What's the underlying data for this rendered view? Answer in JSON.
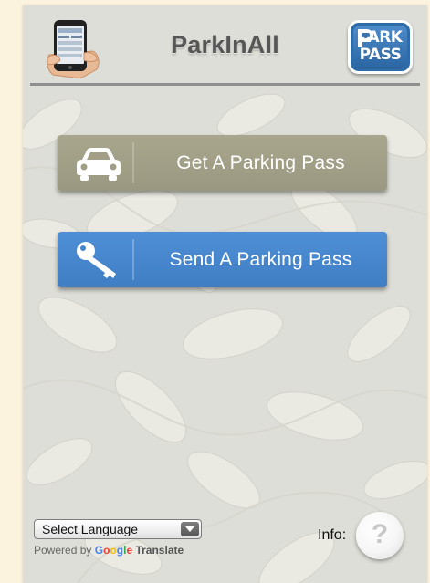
{
  "app": {
    "title": "ParkInAll"
  },
  "logos": {
    "left": "phone-hand-logo",
    "right": {
      "line1": "ARK",
      "line2": "PASS",
      "color": "#2e6ca9"
    }
  },
  "actions": [
    {
      "label": "Get A Parking Pass",
      "icon": "car-icon",
      "color": "#a9a68e"
    },
    {
      "label": "Send A Parking Pass",
      "icon": "key-icon",
      "color": "#4a88cf"
    }
  ],
  "footer": {
    "language_select": {
      "value": "Select Language"
    },
    "powered_by": {
      "prefix": "Powered by",
      "brand_letters": [
        "G",
        "o",
        "o",
        "g",
        "l",
        "e"
      ],
      "suffix": "Translate"
    },
    "info": {
      "label": "Info:",
      "icon": "question-icon",
      "glyph": "?"
    }
  },
  "colors": {
    "page_background": "#fbf3de",
    "app_background": "#deded8",
    "title_text": "#565656",
    "divider": "#8f8f8f"
  }
}
